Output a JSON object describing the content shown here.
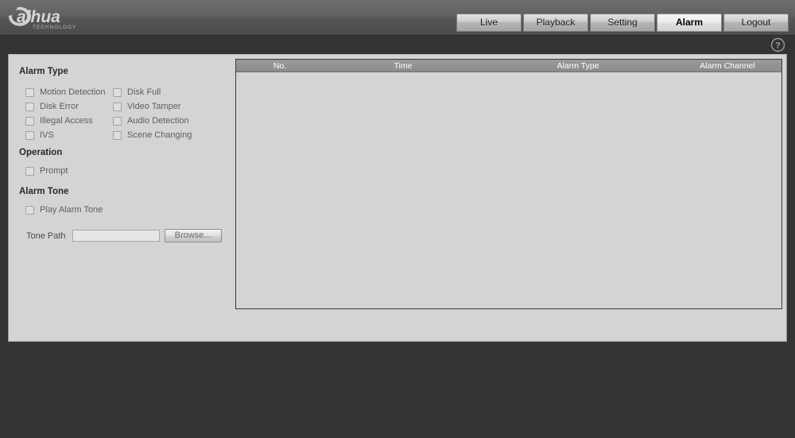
{
  "header": {
    "logo_text": "alhua",
    "logo_sub": "TECHNOLOGY",
    "help_icon": "question-mark-circle-icon",
    "tabs": [
      {
        "label": "Live",
        "active": false
      },
      {
        "label": "Playback",
        "active": false
      },
      {
        "label": "Setting",
        "active": false
      },
      {
        "label": "Alarm",
        "active": true
      },
      {
        "label": "Logout",
        "active": false
      }
    ]
  },
  "settings": {
    "alarm_type": {
      "title": "Alarm Type",
      "items": [
        {
          "label": "Motion Detection",
          "checked": false
        },
        {
          "label": "Disk Full",
          "checked": false
        },
        {
          "label": "Disk Error",
          "checked": false
        },
        {
          "label": "Video Tamper",
          "checked": false
        },
        {
          "label": "Illegal Access",
          "checked": false
        },
        {
          "label": "Audio Detection",
          "checked": false
        },
        {
          "label": "IVS",
          "checked": false
        },
        {
          "label": "Scene Changing",
          "checked": false
        }
      ]
    },
    "operation": {
      "title": "Operation",
      "items": [
        {
          "label": "Prompt",
          "checked": false
        }
      ]
    },
    "alarm_tone": {
      "title": "Alarm Tone",
      "items": [
        {
          "label": "Play Alarm Tone",
          "checked": false
        }
      ],
      "tone_path_label": "Tone Path",
      "tone_path_value": "",
      "tone_path_placeholder": "",
      "browse_label": "Browse..."
    }
  },
  "alarm_table": {
    "columns": [
      "No.",
      "Time",
      "Alarm Type",
      "Alarm Channel"
    ],
    "rows": []
  },
  "colors": {
    "page_background": "#333333",
    "header_bar": "#616161",
    "panel_background": "#d4d4d4",
    "table_header": "#8c8c8c",
    "tab_active": "#ececec",
    "tab_inactive": "#cdcdcd",
    "section_title_text": "#2a2a2a",
    "checkbox_label_text": "#5e5e5e"
  }
}
